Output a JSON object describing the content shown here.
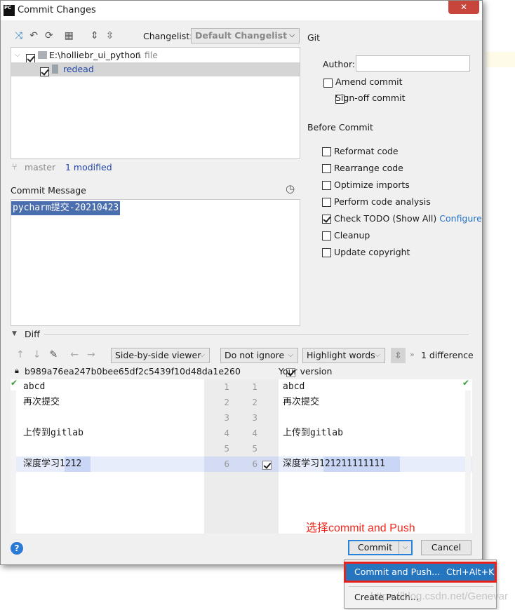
{
  "window": {
    "title": "Commit Changes",
    "close": "✕"
  },
  "toolbar": {
    "changelist_label": "Changelist:",
    "changelist_value": "Default Changelist"
  },
  "tree": {
    "root": "E:\\holliebr_ui_python",
    "root_count": "1 file",
    "file": "redead"
  },
  "status": {
    "branch": "master",
    "modified": "1 modified"
  },
  "commit_message": {
    "label": "Commit Message",
    "value": "pycharm提交-20210423"
  },
  "git": {
    "section": "Git",
    "author_label": "Author:",
    "author_value": "",
    "amend": "Amend commit",
    "signoff": "Sign-off commit"
  },
  "before_commit": {
    "section": "Before Commit",
    "items": [
      {
        "label": "Reformat code",
        "checked": false
      },
      {
        "label": "Rearrange code",
        "checked": false
      },
      {
        "label": "Optimize imports",
        "checked": false
      },
      {
        "label": "Perform code analysis",
        "checked": false
      },
      {
        "label": "Check TODO (Show All)",
        "checked": true,
        "link": "Configure"
      },
      {
        "label": "Cleanup",
        "checked": false
      },
      {
        "label": "Update copyright",
        "checked": false
      }
    ]
  },
  "diff": {
    "label": "Diff",
    "viewer": "Side-by-side viewer",
    "ignore": "Do not ignore",
    "highlight": "Highlight words",
    "differences": "1 difference",
    "left_hash": "b989a76ea247b0bee65df2c5439f10d48da1e260",
    "right_title": "Your version",
    "left_lines": [
      "abcd",
      "再次提交",
      "",
      "上传到gitlab",
      "",
      "深度学习1212"
    ],
    "right_lines": [
      "abcd",
      "再次提交",
      "",
      "上传到gitlab",
      "",
      "深度学习121211111111"
    ],
    "line_numbers": [
      "1",
      "2",
      "3",
      "4",
      "5",
      "6"
    ]
  },
  "annotation": "选择commit and Push",
  "buttons": {
    "help": "?",
    "commit": "Commit",
    "cancel": "Cancel"
  },
  "menu": {
    "items": [
      {
        "label": "Commit and Push...",
        "shortcut": "Ctrl+Alt+K"
      },
      {
        "label": "Create Patch..."
      }
    ]
  },
  "watermark": "https://blog.csdn.net/Genevar"
}
